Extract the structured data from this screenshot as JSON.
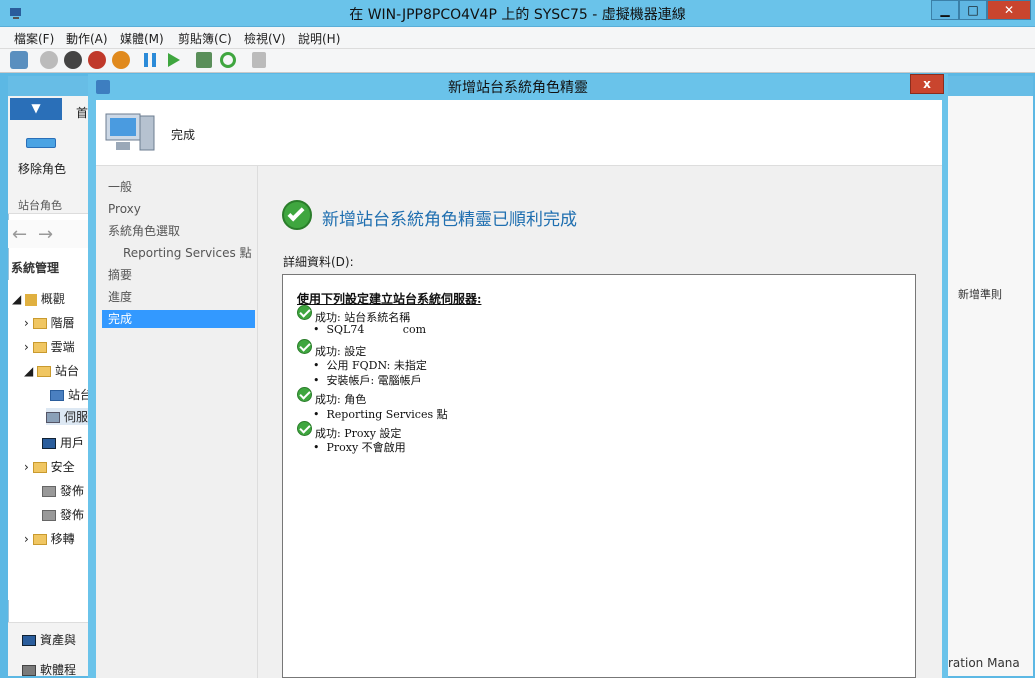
{
  "vm": {
    "title": "在 WIN-JPP8PCO4V4P 上的 SYSC75 - 虛擬機器連線",
    "menu": [
      "檔案(F)",
      "動作(A)",
      "媒體(M)",
      "剪貼簿(C)",
      "檢視(V)",
      "說明(H)"
    ],
    "buttons": {
      "minimize": "▁",
      "maximize": "□",
      "close": "✕"
    }
  },
  "console": {
    "ribbon_tab": "首",
    "remove_role_label": "移除角色",
    "group_label": "站台角色",
    "nav_title": "系統管理",
    "tree": [
      "概觀",
      "階層",
      "雲端",
      "站台",
      "站台",
      "伺服",
      "用戶",
      "安全",
      "發佈",
      "發佈",
      "移轉"
    ],
    "bottom_items": [
      "資產與",
      "軟體程"
    ],
    "right_pane": {
      "new_rule": "新增準則",
      "footer": "ration Mana"
    }
  },
  "wizard": {
    "title": "新增站台系統角色精靈",
    "close": "x",
    "header_label": "完成",
    "nav": [
      "一般",
      "Proxy",
      "系統角色選取",
      "Reporting Services 點",
      "摘要",
      "進度",
      "完成"
    ],
    "success_title": "新增站台系統角色精靈已順利完成",
    "details_label": "詳細資料(D):",
    "details_heading": "使用下列設定建立站台系統伺服器:",
    "details": [
      {
        "status": "成功: 站台系統名稱",
        "items": [
          "SQL74           com"
        ]
      },
      {
        "status": "成功: 設定",
        "items": [
          "公用 FQDN: 未指定",
          "安裝帳戶: 電腦帳戶"
        ]
      },
      {
        "status": "成功: 角色",
        "items": [
          "Reporting Services 點"
        ]
      },
      {
        "status": "成功: Proxy 設定",
        "items": [
          "Proxy 不會啟用"
        ]
      }
    ]
  },
  "colors": {
    "titlebar": "#6ac3ea",
    "accent": "#1f6fb0",
    "selection": "#3399ff",
    "close": "#c9452e",
    "success": "#3fa63f"
  }
}
